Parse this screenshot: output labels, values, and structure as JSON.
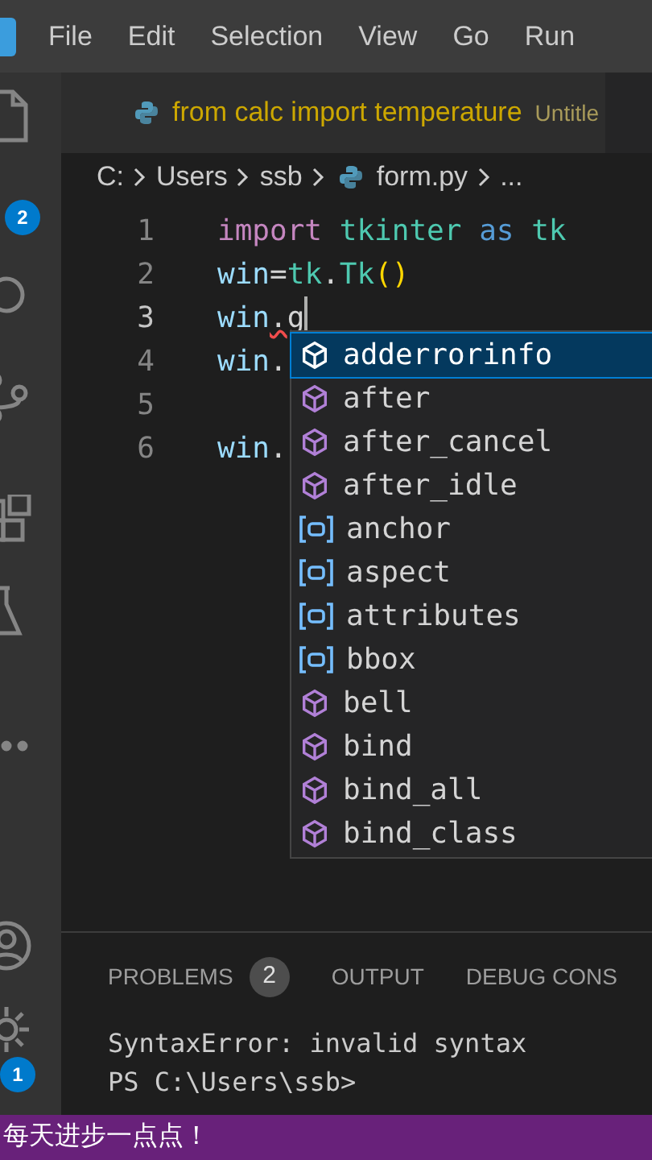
{
  "menu": [
    "File",
    "Edit",
    "Selection",
    "View",
    "Go",
    "Run"
  ],
  "activity_bar": {
    "explorer_badge": "2",
    "settings_badge": "1"
  },
  "tab": {
    "title": "from calc import temperature",
    "description": "Untitle"
  },
  "breadcrumb": [
    "C:",
    "Users",
    "ssb",
    "form.py",
    "..."
  ],
  "code_lines": [
    {
      "number": "1",
      "current": false,
      "tokens": [
        {
          "text": "import ",
          "kind": "keyword"
        },
        {
          "text": "tkinter ",
          "kind": "module"
        },
        {
          "text": "as ",
          "kind": "storage"
        },
        {
          "text": "tk",
          "kind": "module"
        }
      ]
    },
    {
      "number": "2",
      "current": false,
      "tokens": [
        {
          "text": "win",
          "kind": "variable"
        },
        {
          "text": "=",
          "kind": "plain"
        },
        {
          "text": "tk",
          "kind": "module"
        },
        {
          "text": ".",
          "kind": "plain"
        },
        {
          "text": "Tk",
          "kind": "module"
        },
        {
          "text": "()",
          "kind": "bracket"
        }
      ]
    },
    {
      "number": "3",
      "current": true,
      "tokens": [
        {
          "text": "win",
          "kind": "variable"
        },
        {
          "text": ".",
          "kind": "error"
        },
        {
          "text": "g",
          "kind": "plain"
        }
      ]
    },
    {
      "number": "4",
      "current": false,
      "tokens": [
        {
          "text": "win",
          "kind": "variable"
        },
        {
          "text": ".",
          "kind": "plain"
        }
      ]
    },
    {
      "number": "5",
      "current": false
    },
    {
      "number": "6",
      "current": false,
      "tokens": [
        {
          "text": "win",
          "kind": "variable"
        },
        {
          "text": ".",
          "kind": "plain"
        }
      ]
    }
  ],
  "suggestions": [
    {
      "label": "adderrorinfo",
      "kind": "method",
      "selected": true
    },
    {
      "label": "after",
      "kind": "method",
      "selected": false
    },
    {
      "label": "after_cancel",
      "kind": "method",
      "selected": false
    },
    {
      "label": "after_idle",
      "kind": "method",
      "selected": false
    },
    {
      "label": "anchor",
      "kind": "field",
      "selected": false
    },
    {
      "label": "aspect",
      "kind": "field",
      "selected": false
    },
    {
      "label": "attributes",
      "kind": "field",
      "selected": false
    },
    {
      "label": "bbox",
      "kind": "field",
      "selected": false
    },
    {
      "label": "bell",
      "kind": "method",
      "selected": false
    },
    {
      "label": "bind",
      "kind": "method",
      "selected": false
    },
    {
      "label": "bind_all",
      "kind": "method",
      "selected": false
    },
    {
      "label": "bind_class",
      "kind": "method",
      "selected": false
    }
  ],
  "panel": {
    "tabs": [
      {
        "label": "PROBLEMS",
        "count": "2"
      },
      {
        "label": "OUTPUT"
      },
      {
        "label": "DEBUG CONS"
      }
    ],
    "terminal": [
      "SyntaxError: invalid syntax",
      "PS C:\\Users\\ssb>"
    ]
  },
  "caption": "每天进步一点点！"
}
